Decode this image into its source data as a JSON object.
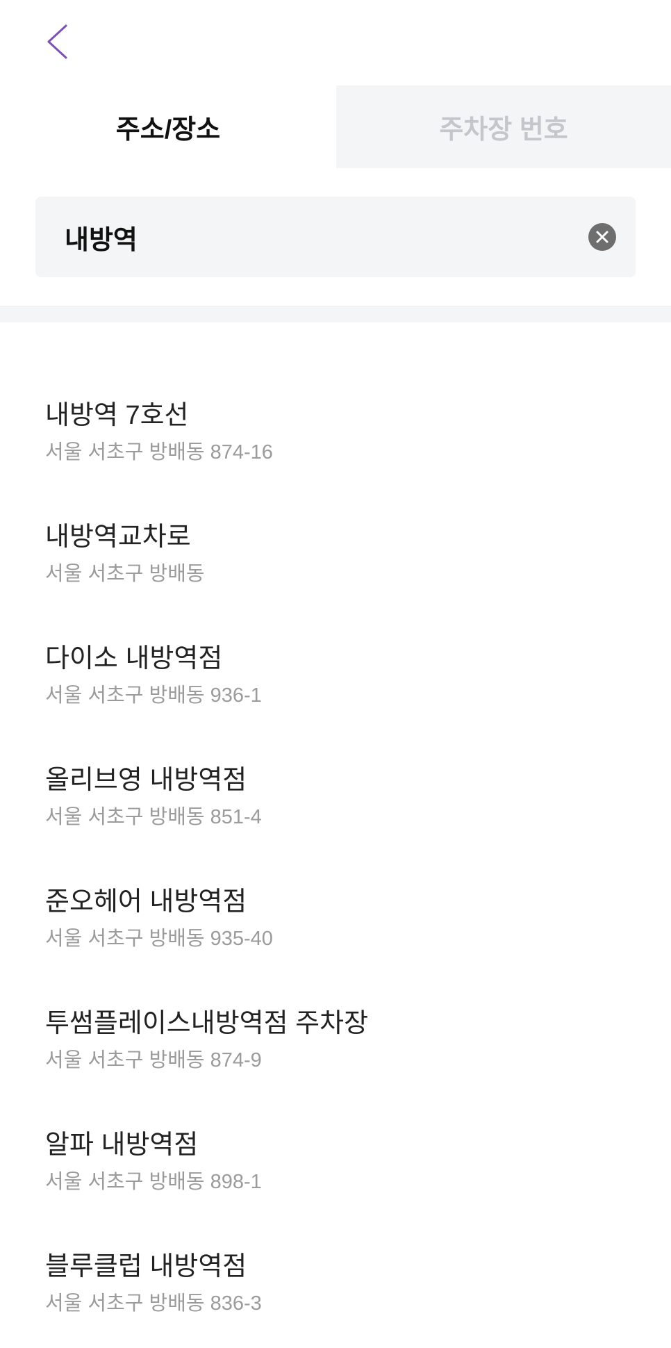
{
  "header": {
    "back_icon": "chevron-left-icon",
    "accent_color": "#7b52b3"
  },
  "tabs": [
    {
      "label": "주소/장소",
      "active": true
    },
    {
      "label": "주차장 번호",
      "active": false
    }
  ],
  "search": {
    "value": "내방역",
    "clear_icon": "clear-circle-icon"
  },
  "results": [
    {
      "name": "내방역 7호선",
      "address": "서울 서초구 방배동 874-16"
    },
    {
      "name": "내방역교차로",
      "address": "서울 서초구 방배동"
    },
    {
      "name": "다이소 내방역점",
      "address": "서울 서초구 방배동 936-1"
    },
    {
      "name": "올리브영 내방역점",
      "address": "서울 서초구 방배동 851-4"
    },
    {
      "name": "준오헤어 내방역점",
      "address": "서울 서초구 방배동 935-40"
    },
    {
      "name": "투썸플레이스내방역점 주차장",
      "address": "서울 서초구 방배동 874-9"
    },
    {
      "name": "알파 내방역점",
      "address": "서울 서초구 방배동 898-1"
    },
    {
      "name": "블루클럽 내방역점",
      "address": "서울 서초구 방배동 836-3"
    }
  ]
}
